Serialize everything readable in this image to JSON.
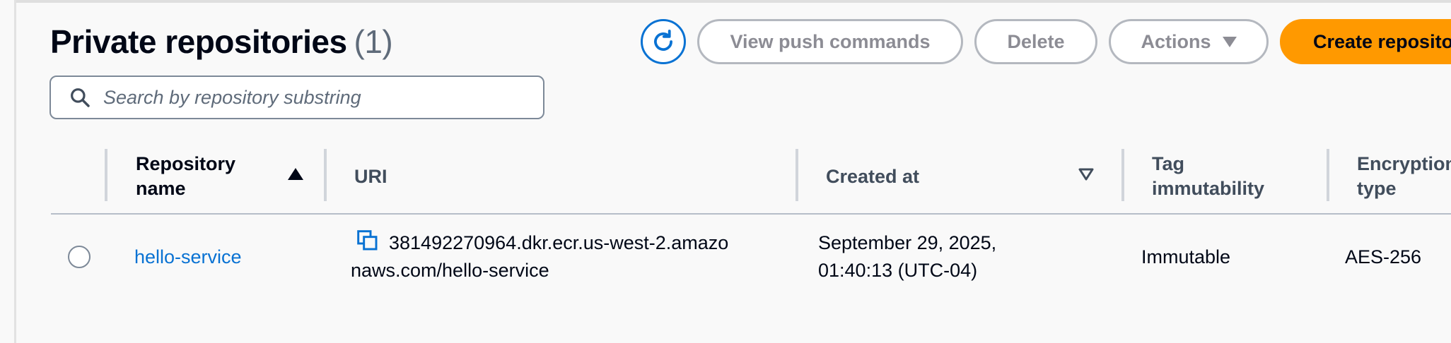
{
  "header": {
    "title": "Private repositories",
    "count": "(1)"
  },
  "toolbar": {
    "refresh_icon": "refresh-icon",
    "view_push_label": "View push commands",
    "delete_label": "Delete",
    "actions_label": "Actions",
    "create_label": "Create repository"
  },
  "search": {
    "placeholder": "Search by repository substring",
    "value": ""
  },
  "table": {
    "columns": [
      {
        "label": "Repository name",
        "sort": "ascending"
      },
      {
        "label": "URI"
      },
      {
        "label": "Created at",
        "sort": "sortable"
      },
      {
        "label": "Tag immutability"
      },
      {
        "label": "Encryption type"
      }
    ],
    "rows": [
      {
        "selected": false,
        "name": "hello-service",
        "uri_line1": "381492270964.dkr.ecr.us-west-2.amazo",
        "uri_line2": "naws.com/hello-service",
        "created_line1": "September 29, 2025,",
        "created_line2": "01:40:13 (UTC-04)",
        "tag_immutability": "Immutable",
        "encryption_type": "AES-256"
      }
    ]
  },
  "colors": {
    "link": "#0972d3",
    "primary_button": "#ff9900",
    "text": "#000716"
  }
}
